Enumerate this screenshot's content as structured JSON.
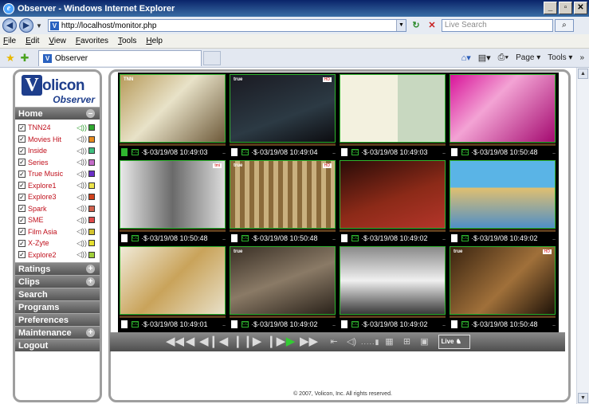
{
  "window": {
    "title": "Observer - Windows Internet Explorer",
    "buttons": [
      "_",
      "□",
      "✕"
    ]
  },
  "address": {
    "url": "http://localhost/monitor.php",
    "search_placeholder": "Live Search"
  },
  "menu": [
    "File",
    "Edit",
    "View",
    "Favorites",
    "Tools",
    "Help"
  ],
  "tab": {
    "label": "Observer"
  },
  "commands": {
    "page": "Page",
    "tools": "Tools"
  },
  "logo": {
    "word": "olicon",
    "v": "V",
    "sub": "Observer"
  },
  "sidebar": {
    "home": "Home",
    "channels": [
      {
        "name": "TNN24",
        "color": "#2fa82f",
        "active": true
      },
      {
        "name": "Movies Hit",
        "color": "#e88b1f",
        "active": false
      },
      {
        "name": "Inside",
        "color": "#3fbf7f",
        "active": false
      },
      {
        "name": "Series",
        "color": "#c46cc9",
        "active": false
      },
      {
        "name": "True Music",
        "color": "#6a2fc7",
        "active": false
      },
      {
        "name": "Explore1",
        "color": "#ede44a",
        "active": false
      },
      {
        "name": "Explore3",
        "color": "#d2421c",
        "active": false
      },
      {
        "name": "Spark",
        "color": "#d2624e",
        "active": false
      },
      {
        "name": "SME",
        "color": "#e04a4a",
        "active": false
      },
      {
        "name": "Film Asia",
        "color": "#d4c42e",
        "active": false
      },
      {
        "name": "X-Zyte",
        "color": "#e6e030",
        "active": false
      },
      {
        "name": "Explore2",
        "color": "#a0cf3a",
        "active": false
      }
    ],
    "sections": [
      {
        "label": "Ratings",
        "plus": true
      },
      {
        "label": "Clips",
        "plus": true
      },
      {
        "label": "Search",
        "plus": false
      },
      {
        "label": "Programs",
        "plus": false
      },
      {
        "label": "Preferences",
        "plus": false
      },
      {
        "label": "Maintenance",
        "plus": true
      },
      {
        "label": "Logout",
        "plus": false
      }
    ]
  },
  "wall": {
    "cells": [
      {
        "time": "03/19/08 10:49:03",
        "green_doc": true,
        "bg": "linear-gradient(135deg,#b79a5a,#e8e2c8 45%,#6e5a3a)",
        "tag": "TNN",
        "badge": ""
      },
      {
        "time": "03/19/08 10:49:04",
        "green_doc": false,
        "bg": "linear-gradient(160deg,#1a1a22,#2c3a44 60%,#0c0c10)",
        "tag": "true",
        "badge": "HD"
      },
      {
        "time": "03/19/08 10:49:03",
        "green_doc": false,
        "bg": "linear-gradient(90deg,#f3f1df 55%,#c8d8c0 55%)",
        "tag": "",
        "badge": ""
      },
      {
        "time": "03/19/08 10:50:48",
        "green_doc": false,
        "bg": "linear-gradient(135deg,#d8149a,#f3a3d4 40%,#a40a70)",
        "tag": "",
        "badge": ""
      },
      {
        "time": "03/19/08 10:50:48",
        "green_doc": false,
        "bg": "linear-gradient(90deg,#e8e8e8,#6a6a6a 50%,#dcdcdc)",
        "tag": "",
        "badge": "tmi"
      },
      {
        "time": "03/19/08 10:50:48",
        "green_doc": false,
        "bg": "repeating-linear-gradient(90deg,#8a6a3a 0 6px,#c9b07e 6px 12px)",
        "tag": "true",
        "badge": "HD"
      },
      {
        "time": "03/19/08 10:49:02",
        "green_doc": false,
        "bg": "linear-gradient(160deg,#2a0c08,#8c2a18 55%,#b4352a)",
        "tag": "",
        "badge": ""
      },
      {
        "time": "03/19/08 10:49:02",
        "green_doc": false,
        "bg": "linear-gradient(180deg,#5ab4e6 40%,#e0c070 40%,#4f8fc7)",
        "tag": "",
        "badge": ""
      },
      {
        "time": "03/19/08 10:49:01",
        "green_doc": false,
        "bg": "linear-gradient(135deg,#f0ead8,#c9a35a 50%,#e8e0c8)",
        "tag": "",
        "badge": ""
      },
      {
        "time": "03/19/08 10:49:02",
        "green_doc": false,
        "bg": "linear-gradient(160deg,#3a3026,#8a7a66 50%,#2a221a)",
        "tag": "true",
        "badge": ""
      },
      {
        "time": "03/19/08 10:49:02",
        "green_doc": false,
        "bg": "linear-gradient(180deg,#8a8a8a,#f0f0f0 50%,#3a3a3a)",
        "tag": "",
        "badge": ""
      },
      {
        "time": "03/19/08 10:50:48",
        "green_doc": false,
        "bg": "linear-gradient(135deg,#3a2410,#a0703a 55%,#1e1208)",
        "tag": "true",
        "badge": "HD"
      }
    ]
  },
  "controls": {
    "buttons": [
      "first",
      "rewind",
      "step-back",
      "back",
      "pause",
      "forward",
      "step-forward",
      "play",
      "fast-forward"
    ],
    "live": "Live"
  },
  "footer": "© 2007, Volicon, Inc. All rights reserved."
}
